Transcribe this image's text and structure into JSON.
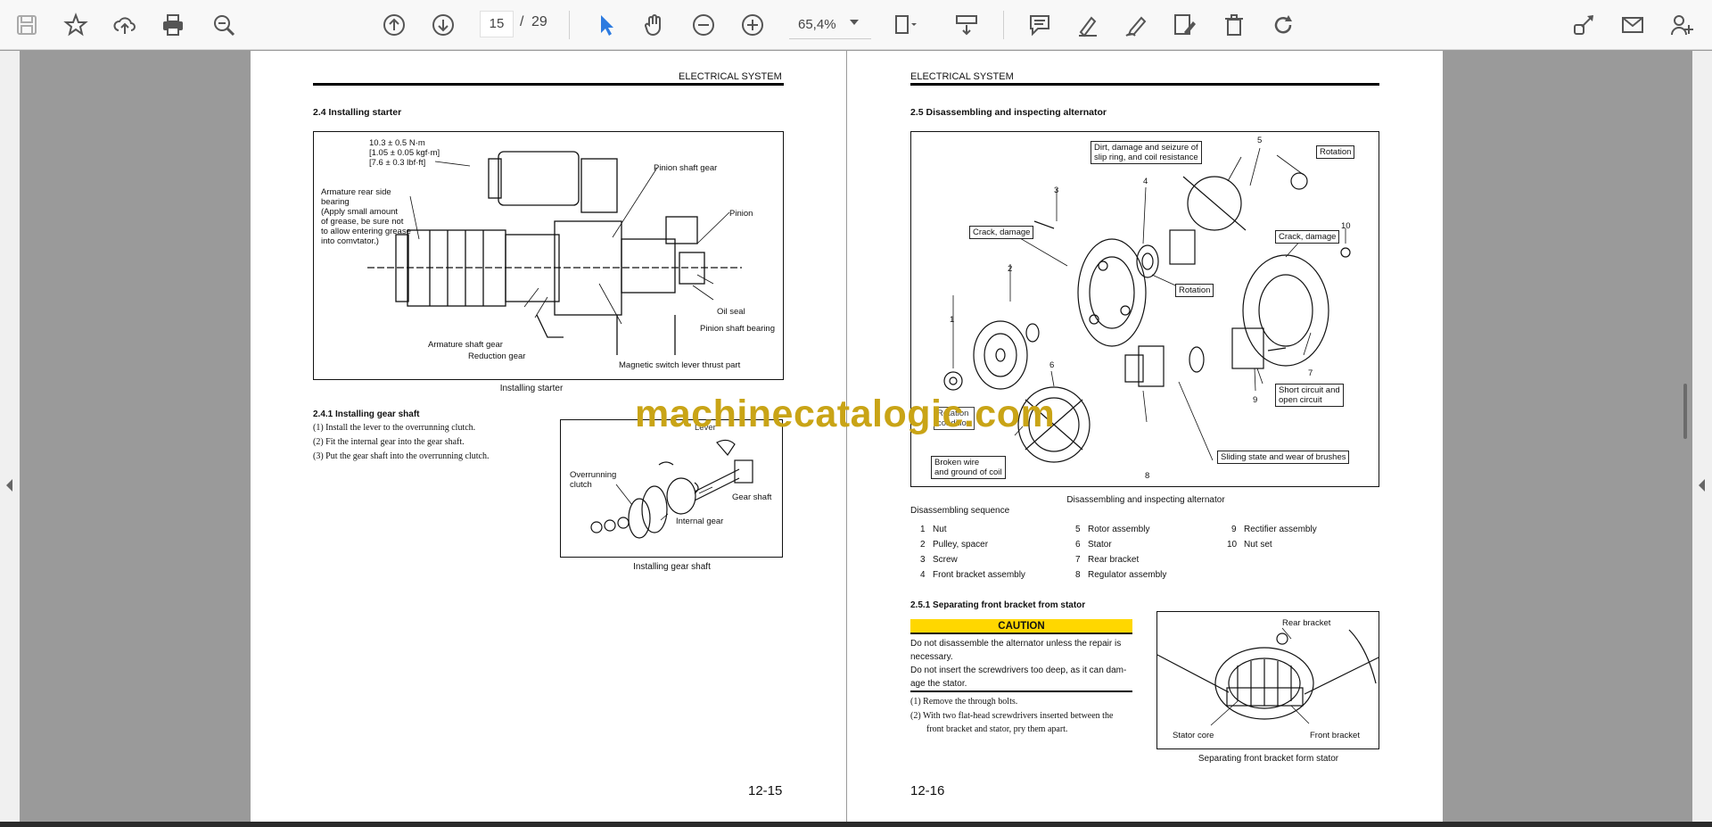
{
  "toolbar": {
    "icons": [
      "save-icon",
      "bookmark-star-icon",
      "upload-cloud-icon",
      "print-icon",
      "zoom-search-icon",
      "page-up-icon",
      "page-down-icon",
      "select-cursor-icon",
      "hand-pan-icon",
      "zoom-out-icon",
      "zoom-in-icon",
      "fit-page-icon",
      "scroll-mode-icon",
      "comment-icon",
      "highlight-pen-icon",
      "draw-pen-icon",
      "edit-sign-icon",
      "delete-trash-icon",
      "redo-icon",
      "share-link-icon",
      "email-icon",
      "add-user-icon"
    ],
    "page_current": "15",
    "page_separator": "/",
    "page_total": "29",
    "zoom": "65,4%",
    "accent": "#2d7be0"
  },
  "left_page": {
    "header": "ELECTRICAL SYSTEM",
    "section_title": "2.4   Installing starter",
    "figure1": {
      "callouts": {
        "torque1": "10.3 ± 0.5 N·m",
        "torque2": "[1.05 ± 0.05 kgf·m]",
        "torque3": "[7.6 ± 0.3 lbf·ft]",
        "armature_l1": "Armature rear side",
        "armature_l2": "bearing",
        "armature_l3": "(Apply  small amount",
        "armature_l4": "of grease, be sure not",
        "armature_l5": "to allow entering grease",
        "armature_l6": "into comvtator.)",
        "pinion_shaft_gear": "Pinion shaft gear",
        "pinion": "Pinion",
        "oil_seal": "Oil seal",
        "pinion_shaft_bearing": "Pinion shaft bearing",
        "armature_shaft_gear": "Armature shaft gear",
        "reduction_gear": "Reduction gear",
        "magnetic_switch": "Magnetic switch lever thrust part"
      },
      "caption": "Installing starter"
    },
    "subsection_title": "2.4.1    Installing gear shaft",
    "steps": [
      "(1)  Install the lever to the overrunning clutch.",
      "(2)  Fit the internal gear into the gear shaft.",
      "(3)  Put the gear shaft into the overrunning clutch."
    ],
    "figure2": {
      "callouts": {
        "overrunning_l1": "Overrunning",
        "overrunning_l2": "clutch",
        "gear_shaft": "Gear shaft",
        "internal_gear": "Internal gear",
        "lever": "Lever"
      },
      "caption": "Installing gear shaft"
    },
    "page_number": "12-15"
  },
  "right_page": {
    "header": "ELECTRICAL SYSTEM",
    "section_title": "2.5   Disassembling and inspecting alternator",
    "figure1": {
      "boxes": {
        "dirt_l1": "Dirt, damage and seizure of",
        "dirt_l2": "slip ring, and coil resistance",
        "rotation_top": "Rotation",
        "crack_left": "Crack, damage",
        "crack_right": "Crack, damage",
        "rotation_mid": "Rotation",
        "short_l1": "Short circuit and",
        "short_l2": "open circuit",
        "rotation_cond_l1": "Rotation",
        "rotation_cond_l2": "condition",
        "broken_l1": "Broken wire",
        "broken_l2": "and ground of coil",
        "sliding": "Sliding state and wear of brushes"
      },
      "numbers": [
        "1",
        "2",
        "3",
        "4",
        "5",
        "6",
        "7",
        "8",
        "9",
        "10"
      ],
      "caption": "Disassembling and inspecting alternator"
    },
    "sequence_title": "Disassembling sequence",
    "sequence": [
      {
        "n": "1",
        "label": "Nut"
      },
      {
        "n": "2",
        "label": "Pulley, spacer"
      },
      {
        "n": "3",
        "label": "Screw"
      },
      {
        "n": "4",
        "label": "Front bracket assembly"
      },
      {
        "n": "5",
        "label": "Rotor assembly"
      },
      {
        "n": "6",
        "label": "Stator"
      },
      {
        "n": "7",
        "label": "Rear bracket"
      },
      {
        "n": "8",
        "label": "Regulator assembly"
      },
      {
        "n": "9",
        "label": "Rectifier assembly"
      },
      {
        "n": "10",
        "label": "Nut set"
      }
    ],
    "subsection_title": "2.5.1    Separating front bracket from stator",
    "caution": {
      "title": "CAUTION",
      "line1": "Do not disassemble the alternator unless the repair is",
      "line2": "necessary.",
      "line3": "Do not insert the screwdrivers too deep, as it can dam-",
      "line4": "age the stator.",
      "color": "#ffd700"
    },
    "steps": [
      "(1)  Remove the through bolts.",
      "(2)  With two flat-head screwdrivers inserted between the",
      "front bracket and stator, pry them apart."
    ],
    "figure2": {
      "callouts": {
        "rear_bracket": "Rear bracket",
        "stator_core": "Stator core",
        "front_bracket": "Front bracket"
      },
      "caption": "Separating front bracket form stator"
    },
    "page_number": "12-16"
  },
  "watermark": "machinecatalogic.com"
}
